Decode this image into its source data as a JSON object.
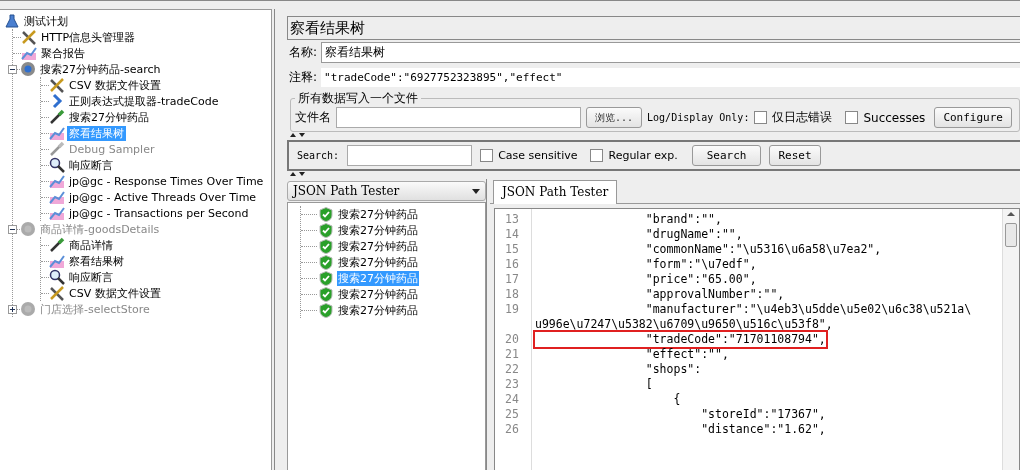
{
  "tree": {
    "items": [
      {
        "label": "测试计划",
        "kind": "plan",
        "selected": false,
        "disabled": false,
        "children": [
          {
            "label": "HTTP信息头管理器",
            "kind": "tools",
            "selected": false,
            "disabled": false
          },
          {
            "label": "聚合报告",
            "kind": "graph",
            "selected": false,
            "disabled": false
          },
          {
            "label": "搜索27分钟药品-search",
            "kind": "gear",
            "selected": false,
            "disabled": false,
            "expanded": true,
            "children": [
              {
                "label": "CSV 数据文件设置",
                "kind": "tools",
                "selected": false,
                "disabled": false
              },
              {
                "label": "正则表达式提取器-tradeCode",
                "kind": "regex",
                "selected": false,
                "disabled": false
              },
              {
                "label": "搜索27分钟药品",
                "kind": "dropper",
                "selected": false,
                "disabled": false
              },
              {
                "label": "察看结果树",
                "kind": "graph",
                "selected": true,
                "disabled": false
              },
              {
                "label": "Debug Sampler",
                "kind": "dropper",
                "selected": false,
                "disabled": true
              },
              {
                "label": "响应断言",
                "kind": "magnifier",
                "selected": false,
                "disabled": false
              },
              {
                "label": "jp@gc - Response Times Over Time",
                "kind": "graph",
                "selected": false,
                "disabled": false
              },
              {
                "label": "jp@gc - Active Threads Over Time",
                "kind": "graph",
                "selected": false,
                "disabled": false
              },
              {
                "label": "jp@gc - Transactions per Second",
                "kind": "graph",
                "selected": false,
                "disabled": false
              }
            ]
          },
          {
            "label": "商品详情-goodsDetails",
            "kind": "gear",
            "selected": false,
            "disabled": true,
            "expanded": true,
            "children": [
              {
                "label": "商品详情",
                "kind": "dropper",
                "selected": false,
                "disabled": false
              },
              {
                "label": "察看结果树",
                "kind": "graph",
                "selected": false,
                "disabled": false
              },
              {
                "label": "响应断言",
                "kind": "magnifier",
                "selected": false,
                "disabled": false
              },
              {
                "label": "CSV 数据文件设置",
                "kind": "tools",
                "selected": false,
                "disabled": false
              }
            ]
          },
          {
            "label": "门店选择-selectStore",
            "kind": "gear",
            "selected": false,
            "disabled": true,
            "expanded": false
          }
        ]
      }
    ]
  },
  "panel": {
    "title": "察看结果树",
    "name_label": "名称:",
    "name_value": "察看结果树",
    "comment_label": "注释:",
    "comment_value": "\"tradeCode\":\"6927752323895\",\"effect\"",
    "file_group": {
      "legend": "所有数据写入一个文件",
      "file_label": "文件名",
      "browse_button": "浏览...",
      "log_label": "Log/Display Only:",
      "checkboxes": [
        {
          "label": "仅日志错误",
          "checked": false
        },
        {
          "label": "Successes",
          "checked": false
        }
      ],
      "configure_button": "Configure"
    }
  },
  "search": {
    "label": "Search:",
    "checkboxes": [
      {
        "label": "Case sensitive",
        "checked": false
      },
      {
        "label": "Regular exp.",
        "checked": false
      }
    ],
    "search_button": "Search",
    "reset_button": "Reset"
  },
  "results": {
    "renderer": "JSON Path Tester",
    "items": [
      {
        "label": "搜索27分钟药品",
        "selected": false
      },
      {
        "label": "搜索27分钟药品",
        "selected": false
      },
      {
        "label": "搜索27分钟药品",
        "selected": false
      },
      {
        "label": "搜索27分钟药品",
        "selected": false
      },
      {
        "label": "搜索27分钟药品",
        "selected": true
      },
      {
        "label": "搜索27分钟药品",
        "selected": false
      },
      {
        "label": "搜索27分钟药品",
        "selected": false
      }
    ]
  },
  "tabs": [
    {
      "label": "JSON Path Tester",
      "selected": true
    }
  ],
  "code": {
    "lines": [
      {
        "number": "13",
        "text": "                \"brand\":\"\",",
        "highlighted": false
      },
      {
        "number": "14",
        "text": "                \"drugName\":\"\",",
        "highlighted": false
      },
      {
        "number": "15",
        "text": "                \"commonName\":\"\\u5316\\u6a58\\u7ea2\",",
        "highlighted": false
      },
      {
        "number": "16",
        "text": "                \"form\":\"\\u7edf\",",
        "highlighted": false
      },
      {
        "number": "17",
        "text": "                \"price\":\"65.00\",",
        "highlighted": false
      },
      {
        "number": "18",
        "text": "                \"approvalNumber\":\"\",",
        "highlighted": false
      },
      {
        "number": "19",
        "text": "                \"manufacturer\":\"\\u4eb3\\u5dde\\u5e02\\u6c38\\u521a\\",
        "highlighted": false
      },
      {
        "text": "u996e\\u7247\\u5382\\u6709\\u9650\\u516c\\u53f8\",",
        "highlighted": false
      },
      {
        "number": "20",
        "text": "                \"tradeCode\":\"71701108794\",",
        "highlighted": true
      },
      {
        "number": "21",
        "text": "                \"effect\":\"\",",
        "highlighted": false
      },
      {
        "number": "22",
        "text": "                \"shops\":",
        "highlighted": false
      },
      {
        "number": "23",
        "text": "                [",
        "highlighted": false
      },
      {
        "number": "24",
        "text": "                    {",
        "highlighted": false
      },
      {
        "number": "25",
        "text": "                        \"storeId\":\"17367\",",
        "highlighted": false
      },
      {
        "number": "26",
        "text": "                        \"distance\":\"1.62\",",
        "highlighted": false
      }
    ]
  }
}
